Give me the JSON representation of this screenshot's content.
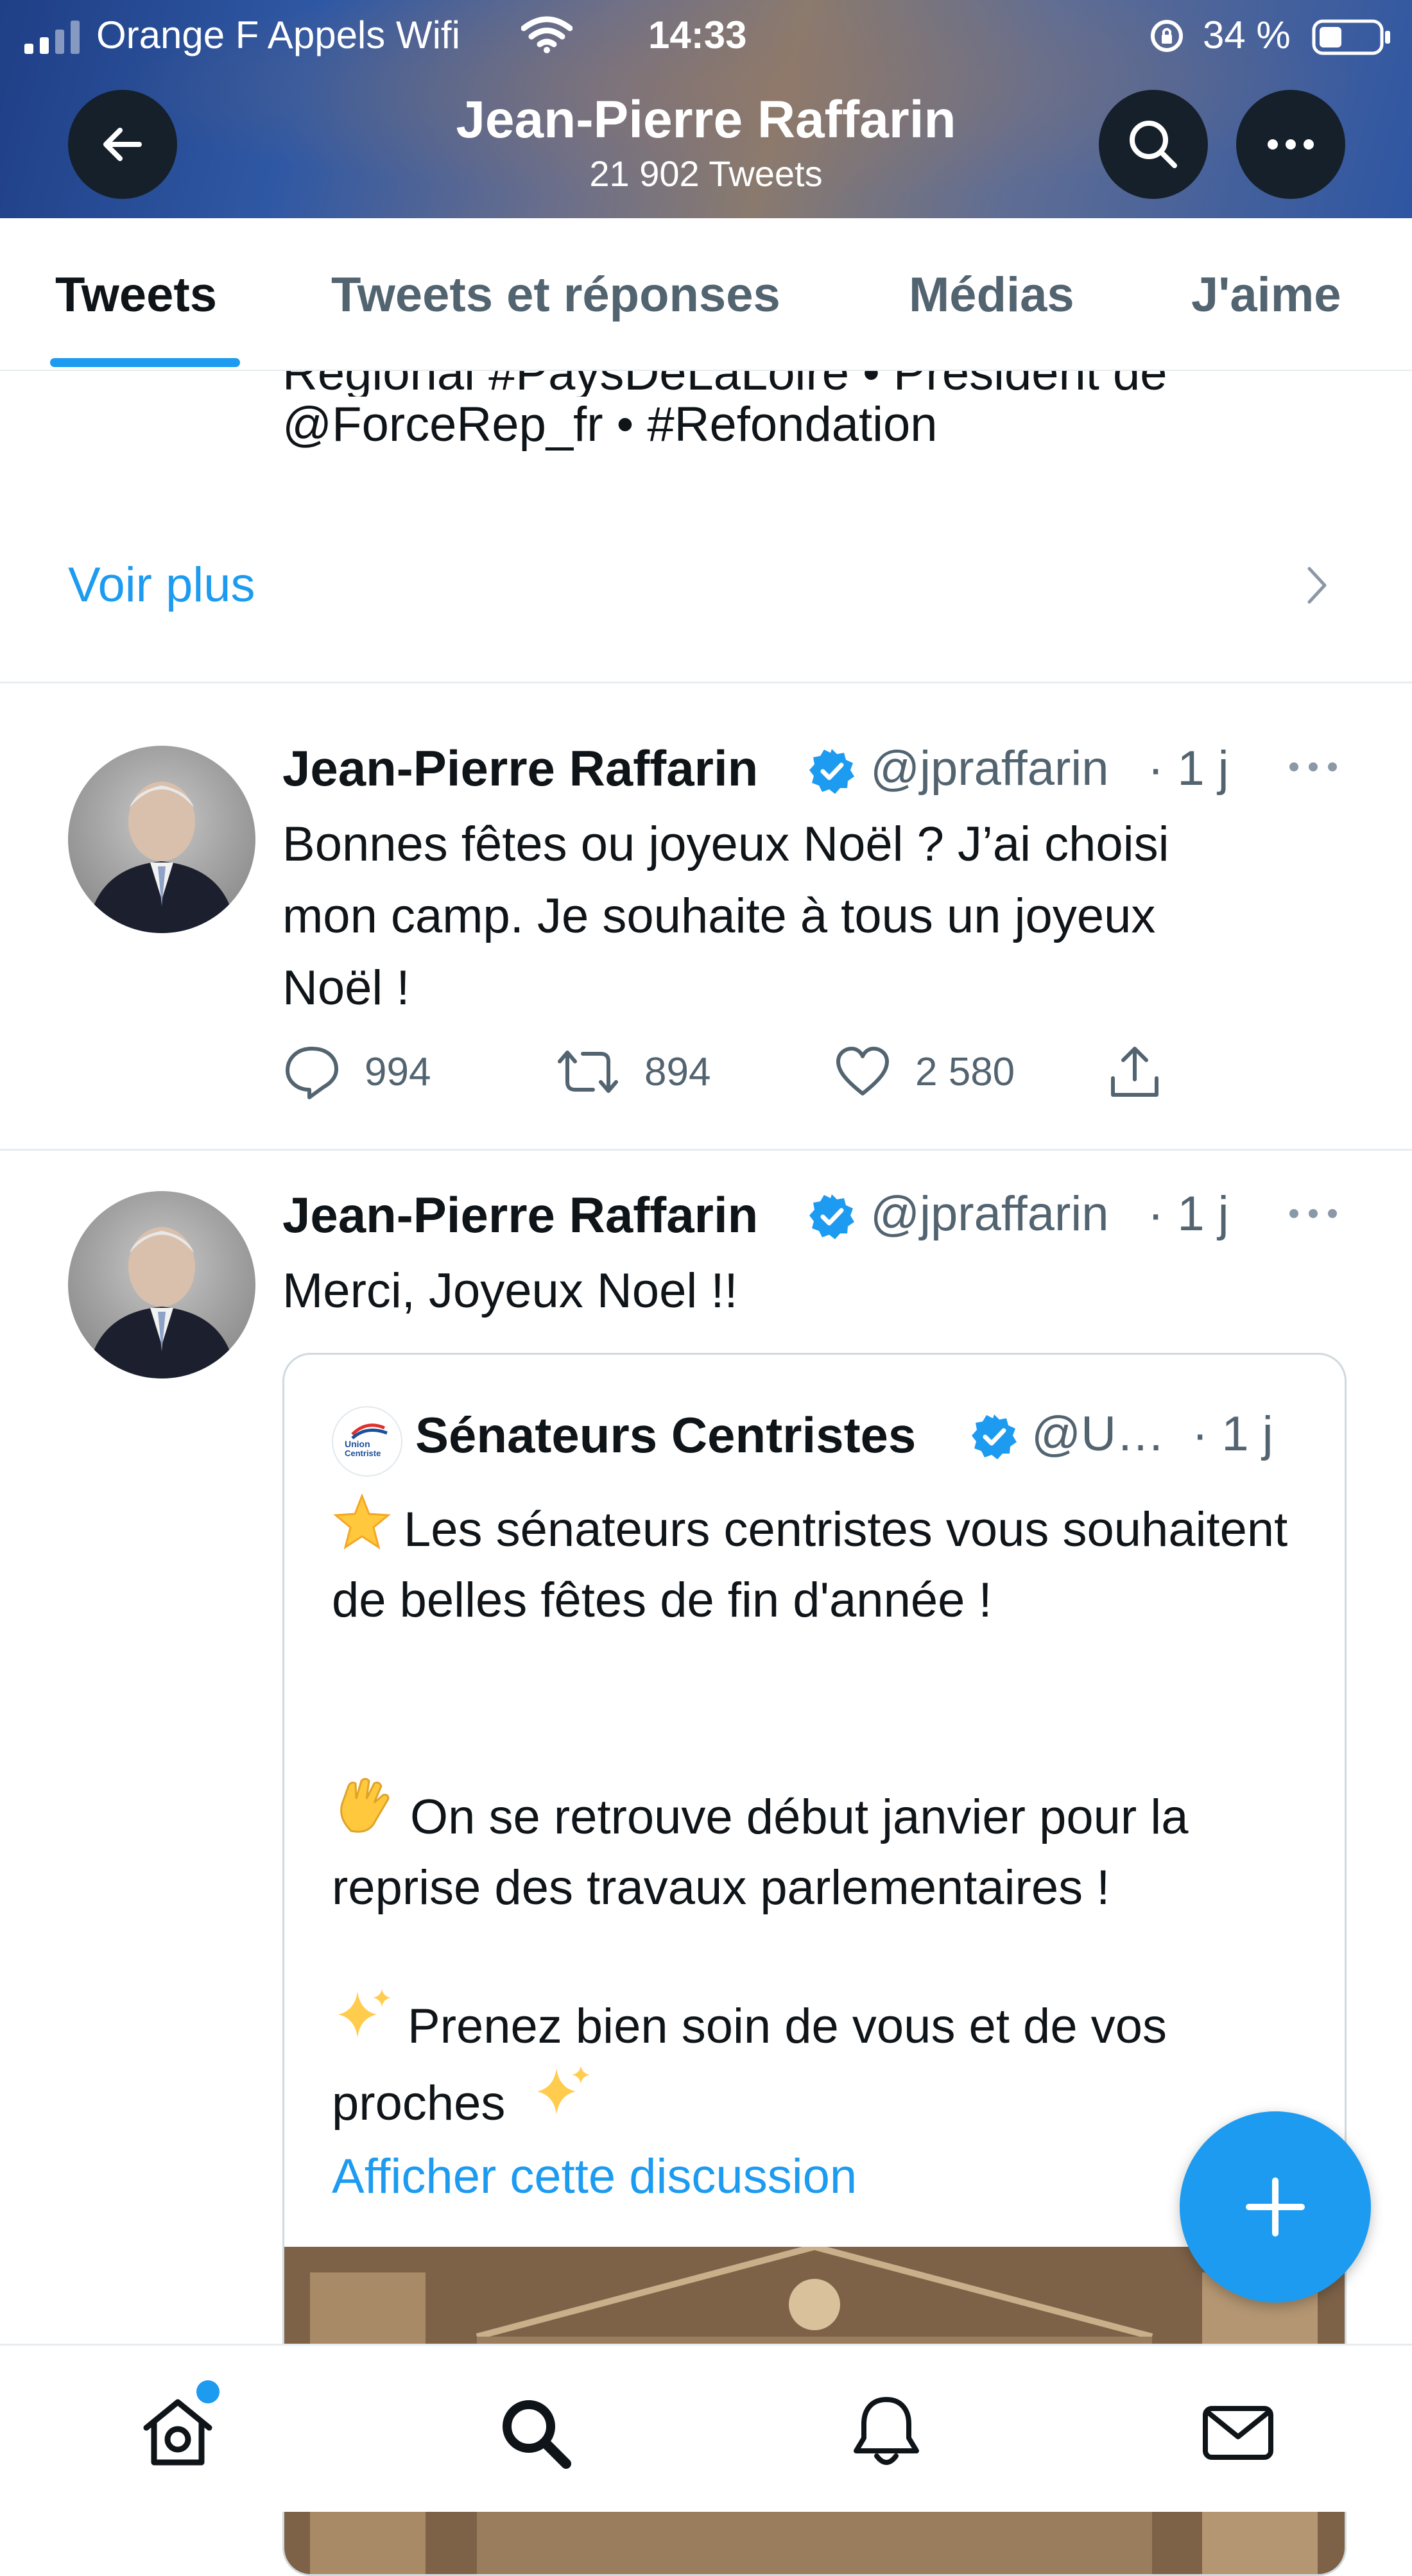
{
  "status_bar": {
    "carrier": "Orange F Appels Wifi",
    "time": "14:33",
    "battery": "34 %"
  },
  "header": {
    "title": "Jean-Pierre Raffarin",
    "tweet_count": "21 902 Tweets"
  },
  "tabs": [
    {
      "label": "Tweets",
      "active": true
    },
    {
      "label": "Tweets et réponses",
      "active": false
    },
    {
      "label": "Médias",
      "active": false
    },
    {
      "label": "J'aime",
      "active": false
    }
  ],
  "bio": {
    "cut_line": "Régional #PaysDeLaLoire • Président de",
    "last_line": "@ForceRep_fr • #Refondation",
    "see_more": "Voir plus"
  },
  "tweets": [
    {
      "name": "Jean-Pierre Raffarin",
      "handle": "@jpraffarin",
      "time": "· 1 j",
      "text": "Bonnes fêtes ou joyeux Noël ? J’ai choisi\nmon camp. Je souhaite à tous un joyeux\nNoël !",
      "replies": "994",
      "retweets": "894",
      "likes": "2 580"
    },
    {
      "name": "Jean-Pierre Raffarin",
      "handle": "@jpraffarin",
      "time": "· 1 j",
      "text": "Merci, Joyeux Noel !!",
      "quote": {
        "name": "Sénateurs Centristes",
        "handle": "@U…",
        "time": "· 1 j",
        "p1": "Les sénateurs centristes vous souhaitent de belles fêtes de fin d'année !",
        "p2": "On se retrouve début janvier pour la reprise des travaux parlementaires !",
        "p3": "Prenez bien soin de vous et de vos proches",
        "show_thread": "Afficher cette discussion",
        "logo_text": "Union Centriste"
      }
    }
  ],
  "colors": {
    "accent": "#1d9bf0",
    "text": "#0f1419",
    "muted": "#536471"
  }
}
